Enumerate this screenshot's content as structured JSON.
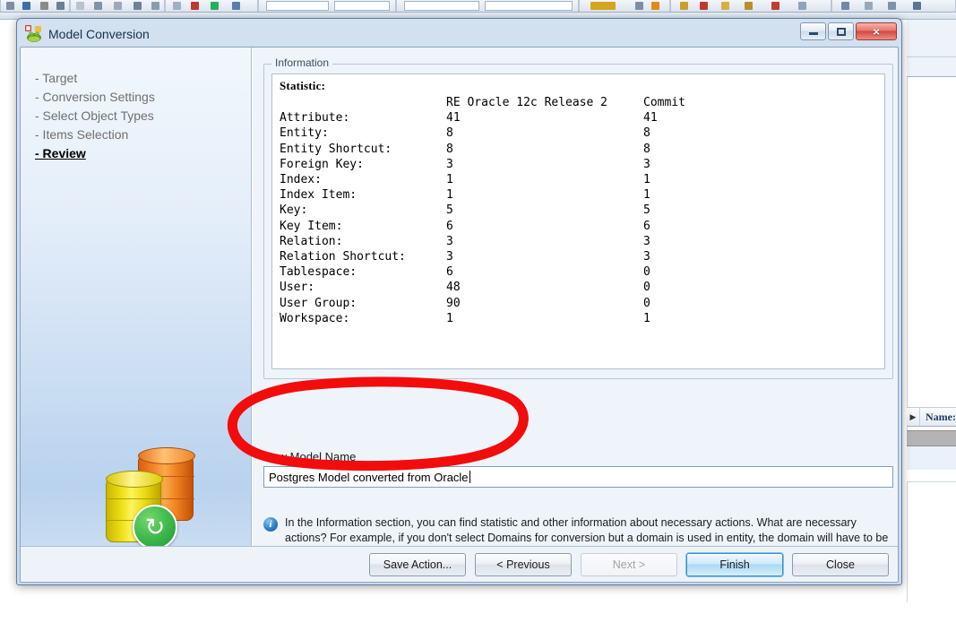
{
  "window": {
    "title": "Model Conversion",
    "icon": "toad-frog-icon",
    "controls": {
      "minimize": "minimize-button",
      "maximize": "maximize-button",
      "close": "×"
    }
  },
  "sidebar": {
    "steps": [
      {
        "label": "- Target",
        "current": false
      },
      {
        "label": "- Conversion Settings",
        "current": false
      },
      {
        "label": "- Select Object Types",
        "current": false
      },
      {
        "label": "- Items Selection",
        "current": false
      },
      {
        "label": "- Review",
        "current": true
      }
    ],
    "illustration": "database-conversion-icon"
  },
  "information": {
    "groupbox_title": "Information",
    "statistic_title": "Statistic:",
    "columns": [
      "",
      "RE Oracle 12c Release 2",
      "Commit"
    ],
    "rows": [
      {
        "label": "Attribute:",
        "source": "41",
        "commit": "41"
      },
      {
        "label": "Entity:",
        "source": "8",
        "commit": "8"
      },
      {
        "label": "Entity Shortcut:",
        "source": "8",
        "commit": "8"
      },
      {
        "label": "Foreign Key:",
        "source": "3",
        "commit": "3"
      },
      {
        "label": "Index:",
        "source": "1",
        "commit": "1"
      },
      {
        "label": "Index Item:",
        "source": "1",
        "commit": "1"
      },
      {
        "label": "Key:",
        "source": "5",
        "commit": "5"
      },
      {
        "label": "Key Item:",
        "source": "6",
        "commit": "6"
      },
      {
        "label": "Relation:",
        "source": "3",
        "commit": "3"
      },
      {
        "label": "Relation Shortcut:",
        "source": "3",
        "commit": "3"
      },
      {
        "label": "Tablespace:",
        "source": "6",
        "commit": "0"
      },
      {
        "label": "User:",
        "source": "48",
        "commit": "0"
      },
      {
        "label": "User Group:",
        "source": "90",
        "commit": "0"
      },
      {
        "label": "Workspace:",
        "source": "1",
        "commit": "1"
      }
    ]
  },
  "new_model_name": {
    "label_before": "New M",
    "label_accel": "o",
    "label_after": "del Name",
    "value": "Postgres Model converted from Oracle"
  },
  "note": {
    "icon": "i",
    "text": "In the Information section, you can find statistic and other information about necessary actions. What are necessary actions? For example, if you don't select Domains for conversion but a domain is used in entity, the domain will have to be converted too. Toad Data Modeler will display such information in this area."
  },
  "buttons": [
    {
      "label": "Save Action...",
      "state": "enabled",
      "name": "save-action-button"
    },
    {
      "label": "< Previous",
      "state": "enabled",
      "name": "previous-button"
    },
    {
      "label": "Next >",
      "state": "disabled",
      "name": "next-button"
    },
    {
      "label": "Finish",
      "state": "default",
      "name": "finish-button"
    },
    {
      "label": "Close",
      "state": "enabled",
      "name": "close-button"
    }
  ],
  "background": {
    "right_panel_column_header": "Name:"
  },
  "annotation": {
    "type": "hand-drawn-ellipse",
    "color": "#f30c0c",
    "target": "new-model-name-field"
  }
}
